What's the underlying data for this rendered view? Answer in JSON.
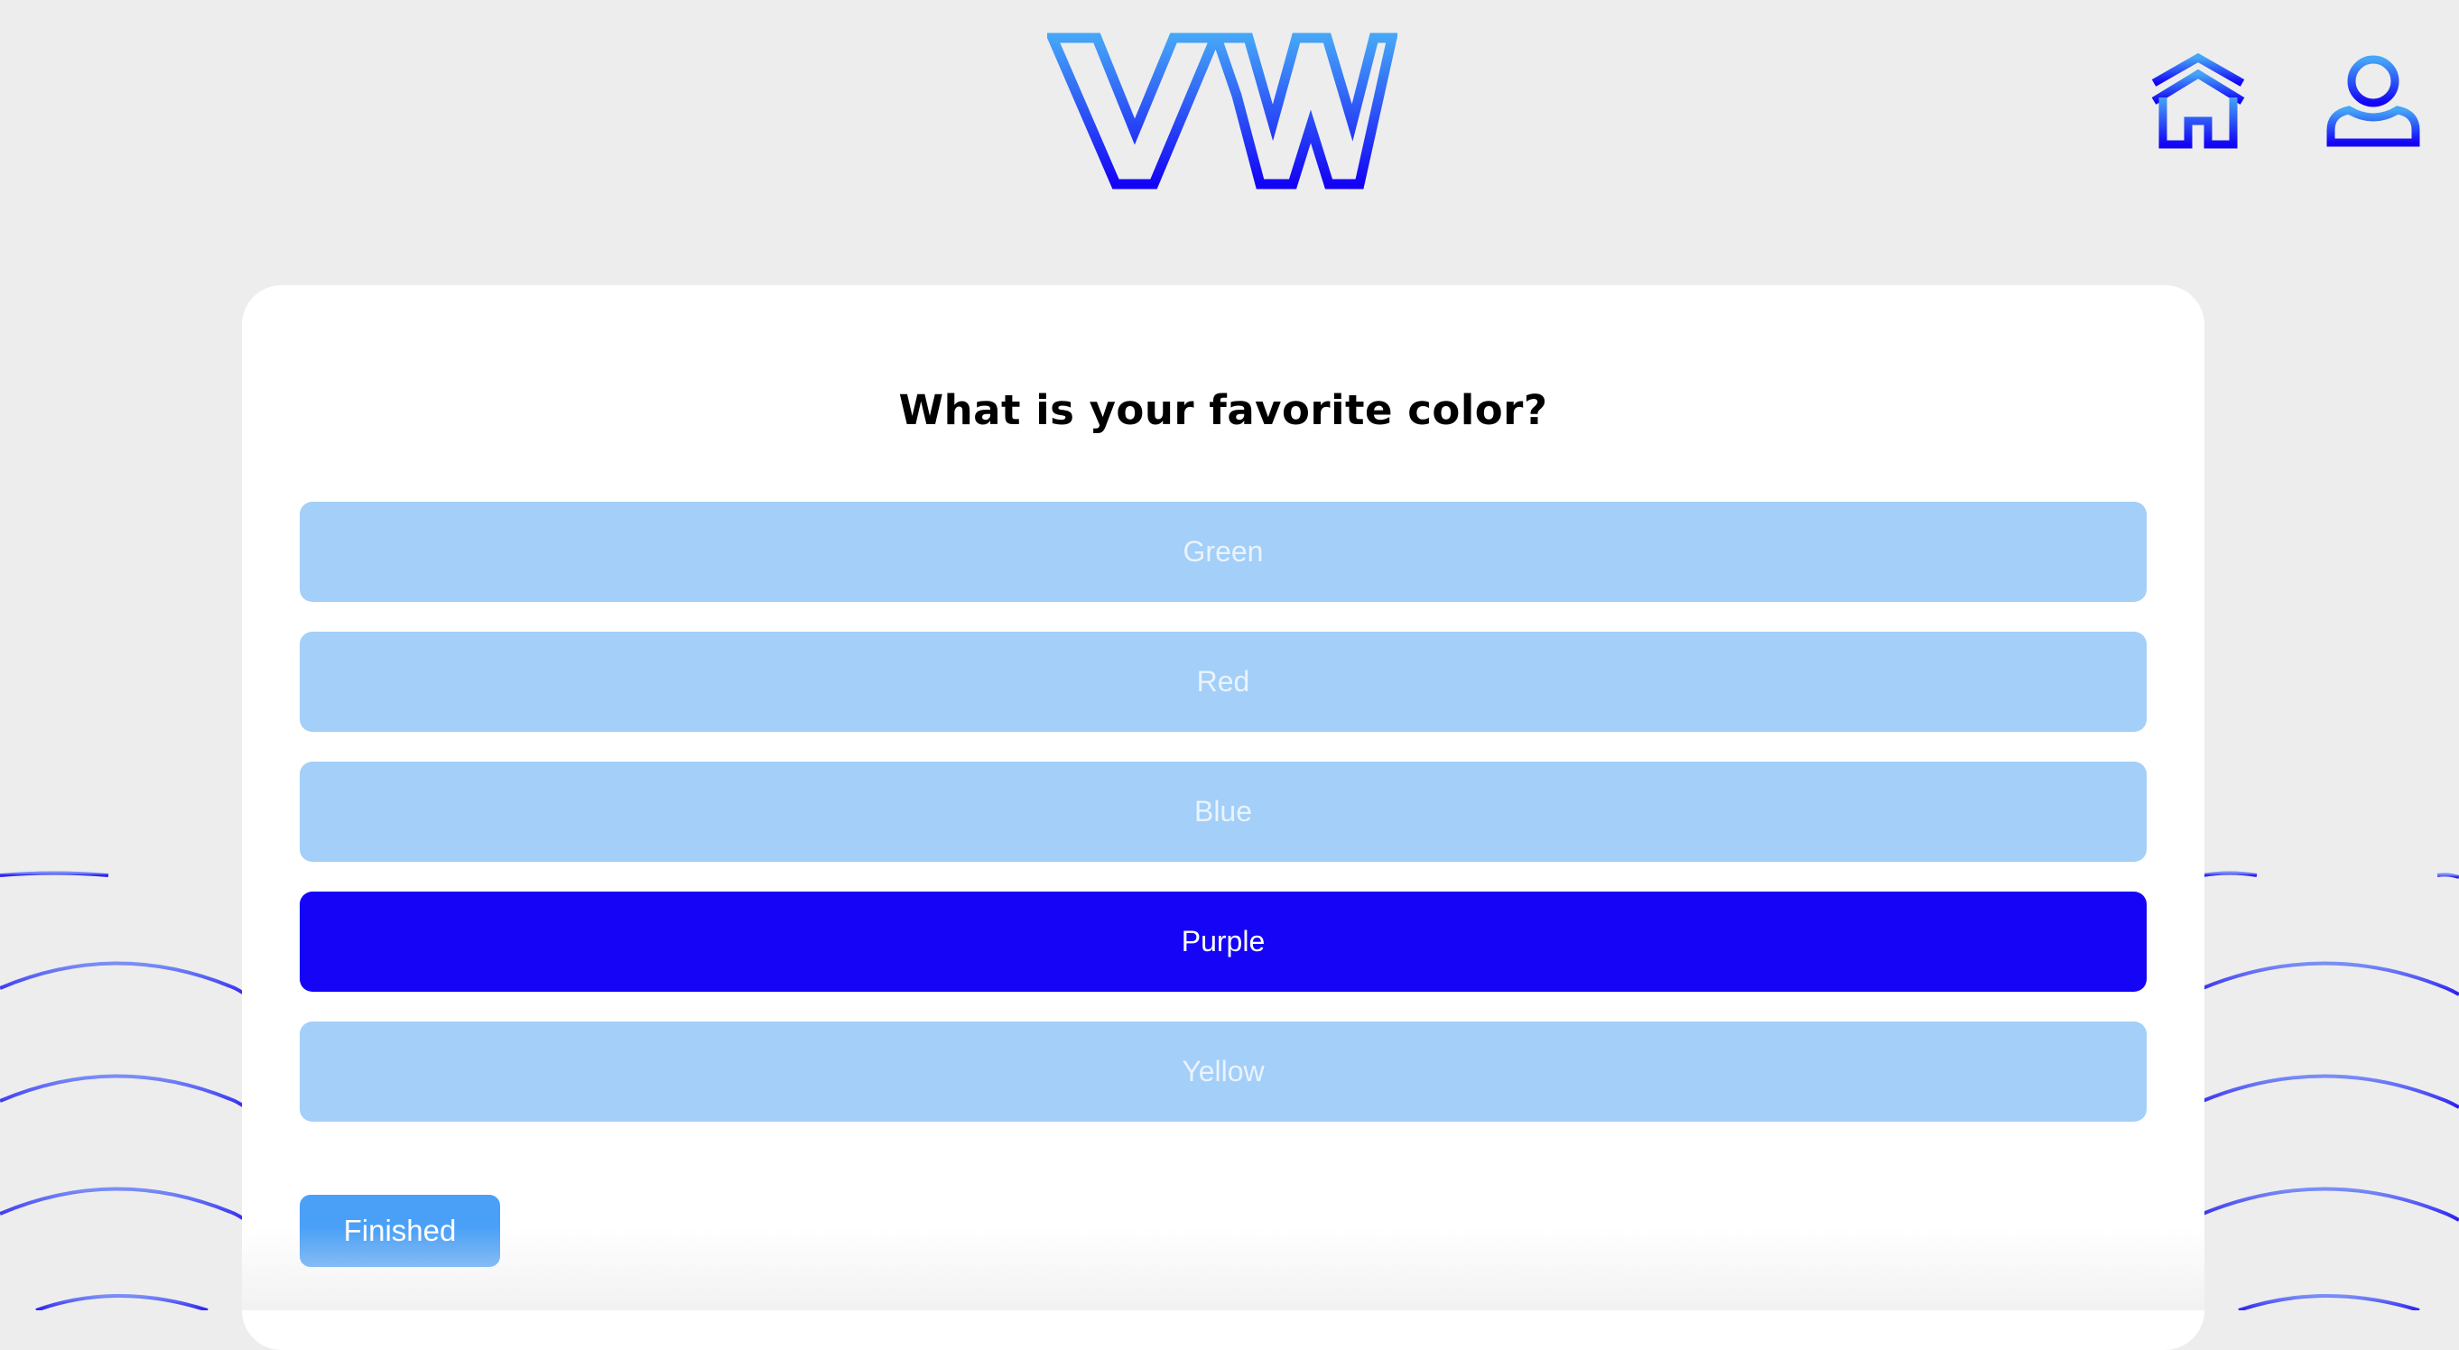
{
  "header": {
    "logo_icon": "vw-logo",
    "home_icon": "home-icon",
    "profile_icon": "user-icon"
  },
  "quiz": {
    "question": "What is your favorite color?",
    "options": [
      {
        "label": "Green",
        "selected": false
      },
      {
        "label": "Red",
        "selected": false
      },
      {
        "label": "Blue",
        "selected": false
      },
      {
        "label": "Purple",
        "selected": true
      },
      {
        "label": "Yellow",
        "selected": false
      }
    ],
    "finished_label": "Finished"
  },
  "colors": {
    "background": "#ededee",
    "card": "#ffffff",
    "option_idle": "#a3cff8",
    "option_selected": "#1504f5",
    "button": "#4aa0f7",
    "accent_light": "#45a5f7",
    "accent_dark": "#1404f5"
  }
}
